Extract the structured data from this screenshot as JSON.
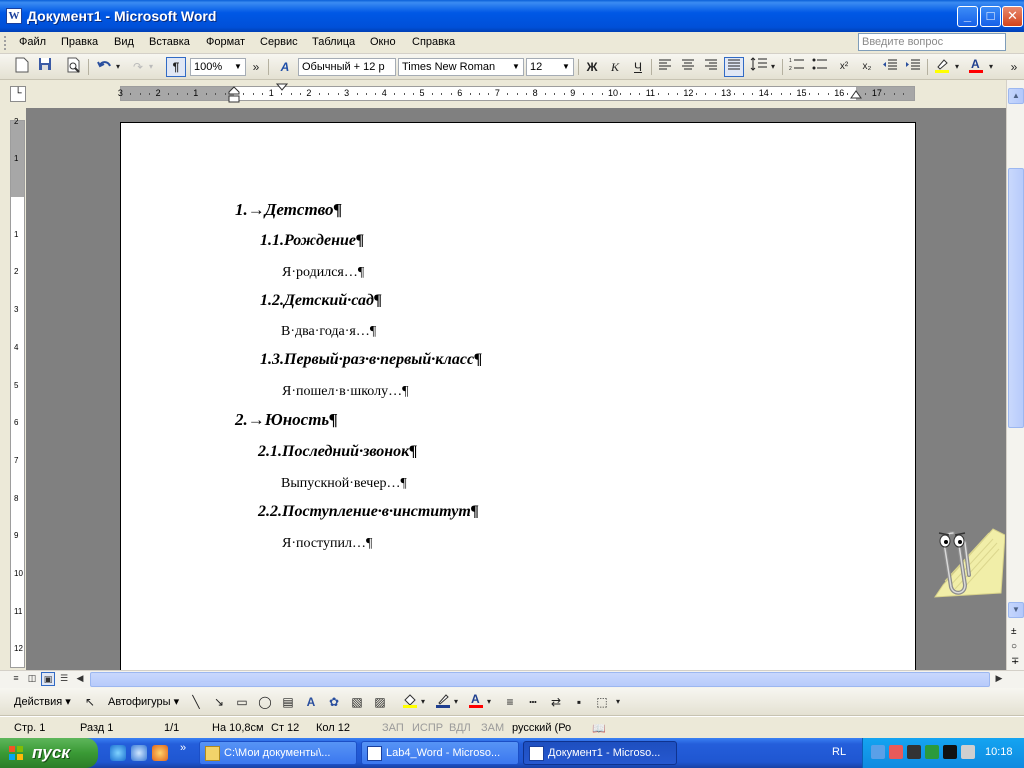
{
  "window": {
    "title": "Документ1 - Microsoft Word",
    "app_icon": "W",
    "min": "_",
    "max": "□",
    "close": "✕"
  },
  "menu": [
    "Файл",
    "Правка",
    "Вид",
    "Вставка",
    "Формат",
    "Сервис",
    "Таблица",
    "Окно",
    "Справка"
  ],
  "help_box": {
    "placeholder": "Введите вопрос"
  },
  "toolbar": {
    "zoom": "100%",
    "style": "Обычный + 12 р",
    "font": "Times New Roman",
    "size": "12",
    "bold": "Ж",
    "italic": "К",
    "underline": "Ч",
    "more": "»"
  },
  "ruler": {
    "h_numbers": [
      "3",
      "2",
      "1",
      "1",
      "2",
      "3",
      "4",
      "5",
      "6",
      "7",
      "8",
      "9",
      "10",
      "11",
      "12",
      "13",
      "14",
      "15",
      "16",
      "17"
    ],
    "v_numbers": [
      "2",
      "1",
      "1",
      "2",
      "3",
      "4",
      "5",
      "6",
      "7",
      "8",
      "9",
      "10",
      "11",
      "12"
    ]
  },
  "document": {
    "headings": [
      {
        "level": 1,
        "text": "1.→Детство¶"
      },
      {
        "level": 2,
        "text": "1.1.Рождение¶"
      },
      {
        "level": 3,
        "text": "Я·родился…¶"
      },
      {
        "level": 2,
        "text": "1.2.Детский·сад¶"
      },
      {
        "level": 3,
        "text": "В·два·года·я…¶"
      },
      {
        "level": 2,
        "text": "1.3.Первый·раз·в·первый·класс¶"
      },
      {
        "level": 3,
        "text": "Я·пошел·в·школу…¶"
      },
      {
        "level": 1,
        "text": "2.→Юность¶"
      },
      {
        "level": 2,
        "text": "2.1.Последний·звонок¶"
      },
      {
        "level": 3,
        "text": "Выпускной·вечер…¶"
      },
      {
        "level": 2,
        "text": "2.2.Поступление·в·институт¶"
      },
      {
        "level": 3,
        "text": "Я·поступил…¶"
      }
    ]
  },
  "drawing": {
    "actions": "Действия ▾",
    "autoshapes": "Автофигуры ▾"
  },
  "status": {
    "page": "Стр.  1",
    "section": "Разд  1",
    "pages": "1/1",
    "at": "На 10,8см",
    "line": "Ст  12",
    "col": "Кол  12",
    "rec": "ЗАП",
    "trk": "ИСПР",
    "ext": "ВДЛ",
    "ovr": "ЗАМ",
    "lang": "русский (Ро"
  },
  "taskbar": {
    "start": "пуск",
    "tasks": [
      {
        "label": "C:\\Мои документы\\...",
        "active": false
      },
      {
        "label": "Lab4_Word - Microso...",
        "active": false
      },
      {
        "label": "Документ1 - Microso...",
        "active": true
      }
    ],
    "more": "»",
    "lang": "RL",
    "clock": "10:18"
  }
}
